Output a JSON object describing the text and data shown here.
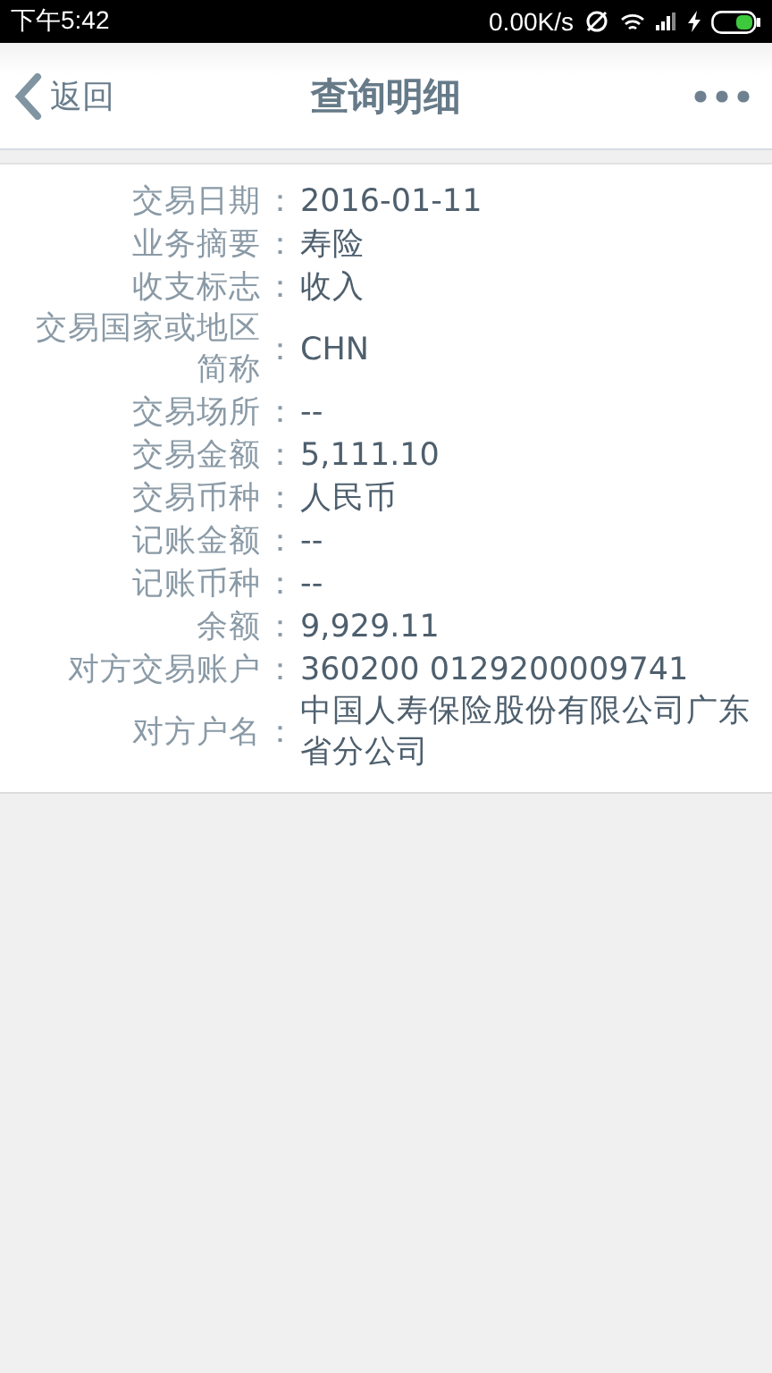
{
  "status_bar": {
    "time": "下午5:42",
    "speed": "0.00K/s"
  },
  "nav": {
    "back": "返回",
    "title": "查询明细"
  },
  "rows": [
    {
      "label": "交易日期",
      "colon": "：",
      "value": "2016-01-11"
    },
    {
      "label": "业务摘要",
      "colon": "：",
      "value": "寿险"
    },
    {
      "label": "收支标志",
      "colon": "：",
      "value": "收入"
    },
    {
      "label": "交易国家或地区简称",
      "colon": "：",
      "value": "CHN"
    },
    {
      "label": "交易场所",
      "colon": "：",
      "value": "--"
    },
    {
      "label": "交易金额",
      "colon": "：",
      "value": "5,111.10"
    },
    {
      "label": "交易币种",
      "colon": "：",
      "value": "人民币"
    },
    {
      "label": "记账金额",
      "colon": "：",
      "value": "--"
    },
    {
      "label": "记账币种",
      "colon": "：",
      "value": "--"
    },
    {
      "label": "余额",
      "colon": "：",
      "value": "9,929.11"
    },
    {
      "label": "对方交易账户",
      "colon": "：",
      "value": "360200 0129200009741"
    },
    {
      "label": "对方户名",
      "colon": "：",
      "value": "中国人寿保险股份有限公司广东省分公司"
    }
  ]
}
